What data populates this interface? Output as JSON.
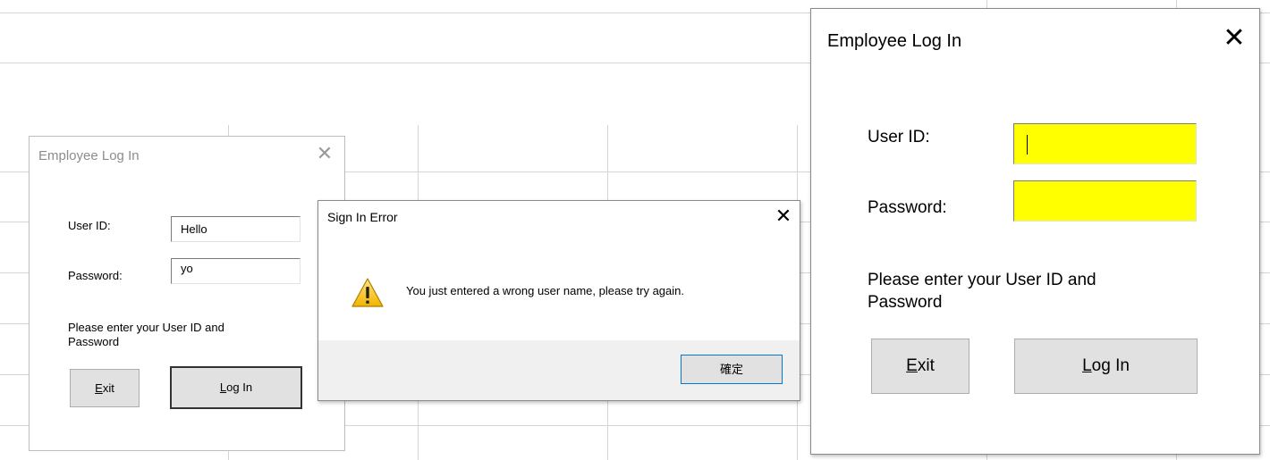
{
  "small_login": {
    "title": "Employee Log In",
    "close_glyph": "✕",
    "user_id_label": "User ID:",
    "user_id_value": "Hello",
    "password_label": "Password:",
    "password_value": "yo",
    "instruction_line1": "Please enter your User ID and",
    "instruction_line2": "Password",
    "exit_mnemonic": "E",
    "exit_rest": "xit",
    "login_mnemonic": "L",
    "login_rest": "og In"
  },
  "error_dialog": {
    "title": "Sign In Error",
    "close_glyph": "✕",
    "icon": "warning-icon",
    "message": "You just entered a wrong user name, please try again.",
    "ok_label": "確定"
  },
  "large_login": {
    "title": "Employee Log In",
    "close_glyph": "✕",
    "user_id_label": "User ID:",
    "user_id_value": "",
    "password_label": "Password:",
    "password_value": "",
    "instruction_line1": "Please enter your User ID and",
    "instruction_line2": "Password",
    "exit_mnemonic": "E",
    "exit_rest": "xit",
    "login_mnemonic": "L",
    "login_rest": "og In",
    "field_color": "#ffff00"
  }
}
